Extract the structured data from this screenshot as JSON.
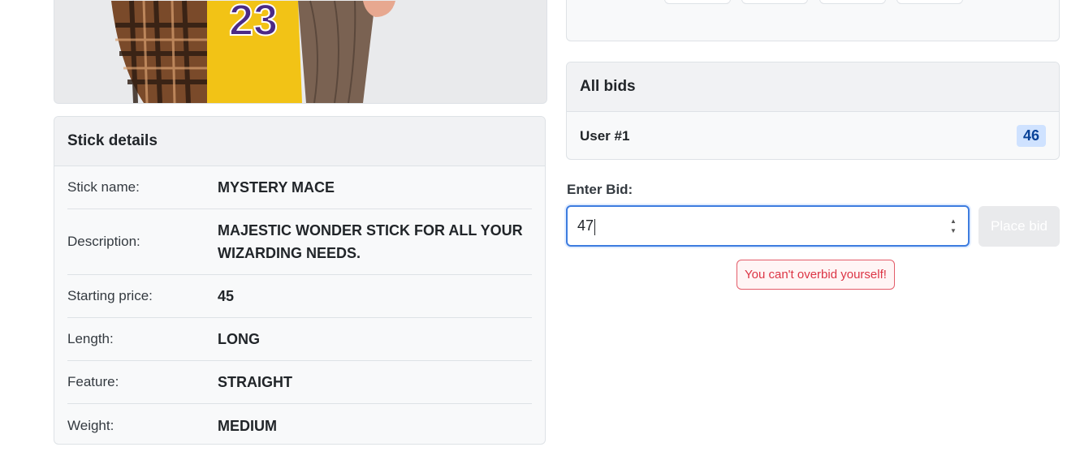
{
  "stick_details": {
    "header": "Stick details",
    "rows": [
      {
        "label": "Stick name:",
        "value": "MYSTERY MACE"
      },
      {
        "label": "Description:",
        "value": "MAJESTIC WONDER STICK FOR ALL YOUR WIZARDING NEEDS."
      },
      {
        "label": "Starting price:",
        "value": "45"
      },
      {
        "label": "Length:",
        "value": "LONG"
      },
      {
        "label": "Feature:",
        "value": "STRAIGHT"
      },
      {
        "label": "Weight:",
        "value": "MEDIUM"
      }
    ]
  },
  "product_image": {
    "jersey_number": "23"
  },
  "bids": {
    "header": "All bids",
    "items": [
      {
        "user": "User #1",
        "amount": "46"
      }
    ]
  },
  "bid_form": {
    "label": "Enter Bid:",
    "value": "47",
    "button_label": "Place bid",
    "error": "You can't overbid yourself!"
  },
  "colors": {
    "accent": "#3d7cdf",
    "badge_bg": "#cfe2ff",
    "error": "#dc3545"
  }
}
